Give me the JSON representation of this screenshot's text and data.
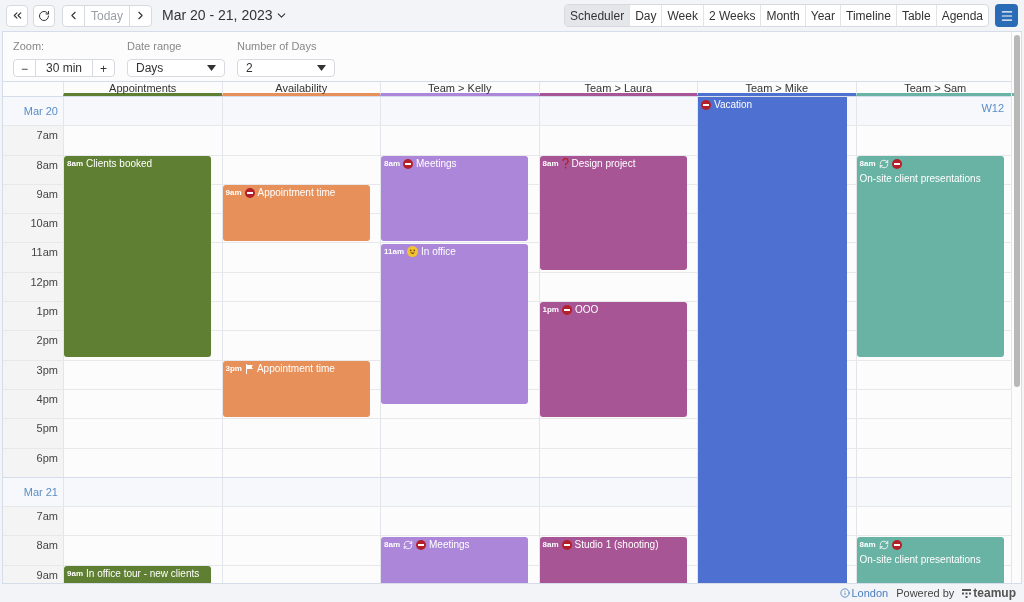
{
  "toolbar": {
    "today": "Today",
    "date_range": "Mar 20 - 21, 2023",
    "views": [
      {
        "label": "Scheduler",
        "selected": true
      },
      {
        "label": "Day",
        "selected": false
      },
      {
        "label": "Week",
        "selected": false
      },
      {
        "label": "2 Weeks",
        "selected": false
      },
      {
        "label": "Month",
        "selected": false
      },
      {
        "label": "Year",
        "selected": false
      },
      {
        "label": "Timeline",
        "selected": false
      },
      {
        "label": "Table",
        "selected": false
      },
      {
        "label": "Agenda",
        "selected": false
      }
    ]
  },
  "options": {
    "zoom": {
      "label": "Zoom:",
      "minus": "−",
      "value": "30 min",
      "plus": "+"
    },
    "date_range": {
      "label": "Date range",
      "value": "Days"
    },
    "number_of_days": {
      "label": "Number of Days",
      "value": "2"
    }
  },
  "columns": [
    {
      "name": "Appointments",
      "color": "#5f7f32",
      "events": [
        {
          "time": "8am",
          "title": "Clients booked"
        },
        {
          "time": "9am",
          "title": "In office tour - new clients"
        }
      ]
    },
    {
      "name": "Availability",
      "color": "#e8905a",
      "events": [
        {
          "time": "9am",
          "title": "Appointment time"
        },
        {
          "time": "3pm",
          "title": "Appointment time"
        }
      ]
    },
    {
      "name": "Team > Kelly",
      "color": "#ac86d9",
      "events": [
        {
          "time": "8am",
          "title": "Meetings"
        },
        {
          "time": "11am",
          "title": "In office"
        },
        {
          "time": "8am",
          "title": "Meetings"
        }
      ]
    },
    {
      "name": "Team > Laura",
      "color": "#a85595",
      "events": [
        {
          "time": "8am",
          "title": "Design project"
        },
        {
          "time": "1pm",
          "title": "OOO"
        },
        {
          "time": "8am",
          "title": "Studio 1 (shooting)"
        }
      ]
    },
    {
      "name": "Team > Mike",
      "color": "#4e70d0",
      "events": [
        {
          "title": "Vacation"
        }
      ]
    },
    {
      "name": "Team > Sam",
      "color": "#69b3a4",
      "events": [
        {
          "time": "8am",
          "title": "On-site client presentations"
        },
        {
          "time": "8am",
          "title": "On-site client presentations"
        }
      ]
    }
  ],
  "days": [
    {
      "label": "Mar 20",
      "week": "W12",
      "hours": [
        "7am",
        "8am",
        "9am",
        "10am",
        "11am",
        "12pm",
        "1pm",
        "2pm",
        "3pm",
        "4pm",
        "5pm",
        "6pm"
      ]
    },
    {
      "label": "Mar 21",
      "hours": [
        "7am",
        "8am",
        "9am"
      ]
    }
  ],
  "footer": {
    "location": "London",
    "powered": "Powered by",
    "brand": "teamup"
  }
}
